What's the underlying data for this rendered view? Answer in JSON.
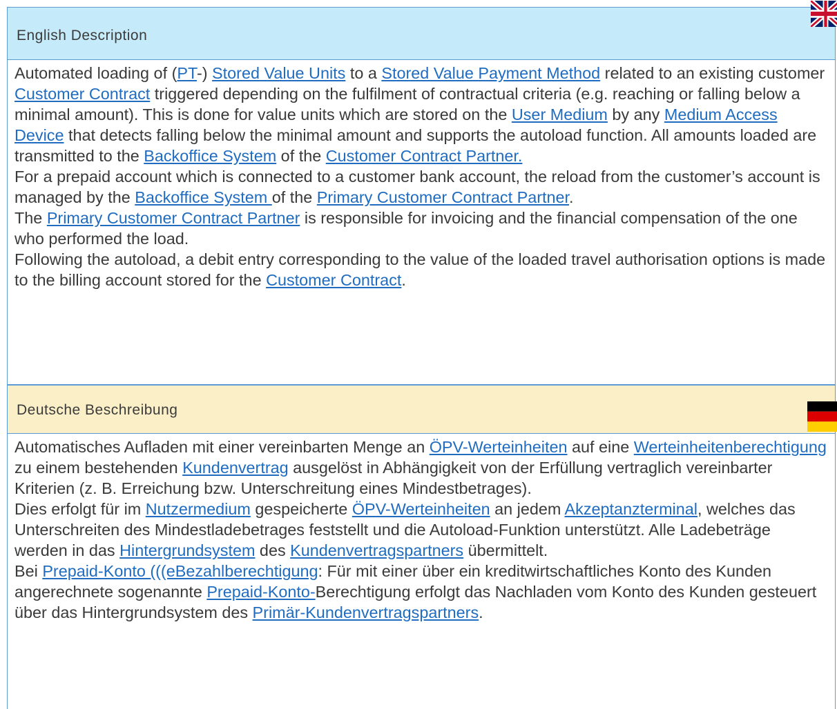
{
  "english": {
    "header": "English Description",
    "flag_icon": "uk-flag-icon",
    "paragraphs": [
      [
        {
          "t": "Automated loading of ("
        },
        {
          "t": "PT",
          "link": true
        },
        {
          "t": "-) "
        },
        {
          "t": "Stored Value Units",
          "link": true
        },
        {
          "t": " to a "
        },
        {
          "t": "Stored Value Payment Method",
          "link": true
        },
        {
          "t": " related to an existing customer "
        },
        {
          "t": "Customer Contract",
          "link": true
        },
        {
          "t": " triggered depending on the fulfilment of contractual criteria (e.g. reaching or falling below a minimal amount). This is done for value units which are stored on the "
        },
        {
          "t": "User Medium",
          "link": true
        },
        {
          "t": " by any "
        },
        {
          "t": "Medium Access Device",
          "link": true
        },
        {
          "t": " that detects falling below the minimal amount and supports the autoload function. All amounts loaded are transmitted to the "
        },
        {
          "t": "Backoffice System",
          "link": true
        },
        {
          "t": " of the "
        },
        {
          "t": "Customer Contract Partner.",
          "link": true
        }
      ],
      [
        {
          "t": "For a prepaid account which is connected to a customer bank account, the reload from the customer’s account is managed by the "
        },
        {
          "t": "Backoffice System ",
          "link": true
        },
        {
          "t": "of the "
        },
        {
          "t": "Primary Customer Contract Partner",
          "link": true
        },
        {
          "t": "."
        }
      ],
      [
        {
          "t": "The "
        },
        {
          "t": "Primary Customer Contract Partner",
          "link": true
        },
        {
          "t": " is responsible for invoicing and the financial compensation of the one who performed the load."
        }
      ],
      [
        {
          "t": "Following the autoload, a debit entry corresponding to the value of the loaded travel authorisation options is made to the billing account stored for the "
        },
        {
          "t": "Customer Contract",
          "link": true
        },
        {
          "t": "."
        }
      ]
    ]
  },
  "german": {
    "header": "Deutsche Beschreibung",
    "flag_icon": "german-flag-icon",
    "paragraphs": [
      [
        {
          "t": "Automatisches Aufladen mit einer vereinbarten Menge an "
        },
        {
          "t": "ÖPV-Werteinheiten",
          "link": true
        },
        {
          "t": " auf eine "
        },
        {
          "t": "Werteinheitenberechtigung",
          "link": true
        },
        {
          "t": " zu einem bestehenden "
        },
        {
          "t": "Kundenvertrag",
          "link": true
        },
        {
          "t": " ausgelöst in Abhängigkeit von der Erfüllung vertraglich vereinbarter Kriterien (z. B. Erreichung bzw. Unterschreitung eines Mindestbetrages)."
        }
      ],
      [
        {
          "t": "Dies erfolgt für im "
        },
        {
          "t": "Nutzermedium",
          "link": true
        },
        {
          "t": " gespeicherte "
        },
        {
          "t": "ÖPV-Werteinheiten",
          "link": true
        },
        {
          "t": " an jedem "
        },
        {
          "t": "Akzeptanzterminal",
          "link": true
        },
        {
          "t": ", welches das Unterschreiten des Mindestladebetrages feststellt und die Autoload-Funktion unterstützt. Alle Ladebeträge werden in das "
        },
        {
          "t": "Hintergrundsystem",
          "link": true
        },
        {
          "t": " des "
        },
        {
          "t": "Kundenvertragspartners",
          "link": true
        },
        {
          "t": " übermittelt."
        }
      ],
      [
        {
          "t": "Bei "
        },
        {
          "t": "Prepaid-Konto  (((eBezahlberechtigung",
          "link": true
        },
        {
          "t": ": Für mit einer über ein kreditwirtschaftliches Konto des Kunden angerechnete sogenannte "
        },
        {
          "t": "Prepaid-Konto-",
          "link": true
        },
        {
          "t": "Berechtigung erfolgt das Nachladen vom Konto des Kunden gesteuert über das Hintergrundsystem des "
        },
        {
          "t": "Primär-Kundenvertragspartners",
          "link": true
        },
        {
          "t": "."
        }
      ]
    ]
  }
}
